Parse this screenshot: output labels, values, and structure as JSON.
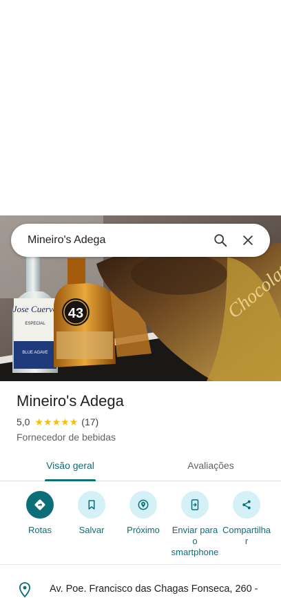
{
  "search": {
    "value": "Mineiro's Adega"
  },
  "place": {
    "name": "Mineiro's Adega",
    "rating": "5,0",
    "stars": 5,
    "reviews": "(17)",
    "category": "Fornecedor de bebidas"
  },
  "tabs": [
    {
      "label": "Visão geral",
      "active": true
    },
    {
      "label": "Avaliações",
      "active": false
    }
  ],
  "actions": [
    {
      "label": "Rotas",
      "icon": "directions-icon"
    },
    {
      "label": "Salvar",
      "icon": "bookmark-icon"
    },
    {
      "label": "Próximo",
      "icon": "nearby-icon"
    },
    {
      "label": "Enviar para o smartphone",
      "icon": "send-to-phone-icon"
    },
    {
      "label": "Compartilhar",
      "icon": "share-icon"
    }
  ],
  "address": {
    "text": "Av. Poe. Francisco das Chagas Fonseca, 260 -"
  },
  "photo": {
    "bottle1_label": "Jose Cuervo",
    "bottle1_sub": "ESPECIAL",
    "bottle1_bottom": "BLUE AGAVE",
    "bottle2_label": "43",
    "bottle3_label": "Chocolate"
  },
  "colors": {
    "accent": "#0b6e79",
    "chip": "#d3f1f6",
    "star": "#fbbc04"
  }
}
